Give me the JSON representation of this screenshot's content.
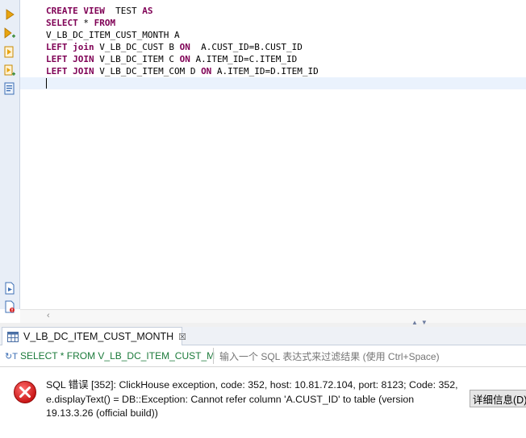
{
  "editor": {
    "lines": [
      [
        {
          "t": "CREATE VIEW",
          "kw": true
        },
        {
          "t": "  TEST "
        },
        {
          "t": "AS",
          "kw": true
        }
      ],
      [
        {
          "t": "SELECT",
          "kw": true
        },
        {
          "t": " * "
        },
        {
          "t": "FROM",
          "kw": true
        }
      ],
      [
        {
          "t": "V_LB_DC_ITEM_CUST_MONTH A"
        }
      ],
      [
        {
          "t": "LEFT join",
          "kw": true
        },
        {
          "t": " V_LB_DC_CUST B "
        },
        {
          "t": "ON",
          "kw": true
        },
        {
          "t": "  A.CUST_ID=B.CUST_ID"
        }
      ],
      [
        {
          "t": "LEFT JOIN",
          "kw": true
        },
        {
          "t": " V_LB_DC_ITEM C "
        },
        {
          "t": "ON",
          "kw": true
        },
        {
          "t": " A.ITEM_ID=C.ITEM_ID"
        }
      ],
      [
        {
          "t": "LEFT JOIN",
          "kw": true
        },
        {
          "t": " V_LB_DC_ITEM_COM D "
        },
        {
          "t": "ON",
          "kw": true
        },
        {
          "t": " A.ITEM_ID=D.ITEM_ID"
        }
      ]
    ]
  },
  "toolbar_icons": [
    "execute-statement-icon",
    "execute-new-tab-icon",
    "execute-script-icon",
    "execute-script-new-tab-icon",
    "explain-plan-icon",
    "load-script-icon",
    "save-script-icon"
  ],
  "result_tab": {
    "label": "V_LB_DC_ITEM_CUST_MONTH",
    "close": "☒"
  },
  "filter": {
    "sql_text": "SELECT * FROM V_LB_DC_ITEM_CUST_M",
    "placeholder": "输入一个 SQL 表达式来过滤结果 (使用 Ctrl+Space)"
  },
  "error": {
    "message": "SQL 错误 [352]: ClickHouse exception, code: 352, host: 10.81.72.104, port: 8123; Code: 352, e.displayText() = DB::Exception: Cannot refer column 'A.CUST_ID' to table (version 19.13.3.26 (official build))",
    "details_label": "详细信息(D)"
  },
  "colors": {
    "keyword": "#7f0055",
    "filter_sql": "#1b7a3a",
    "error_red": "#d81e1e"
  }
}
